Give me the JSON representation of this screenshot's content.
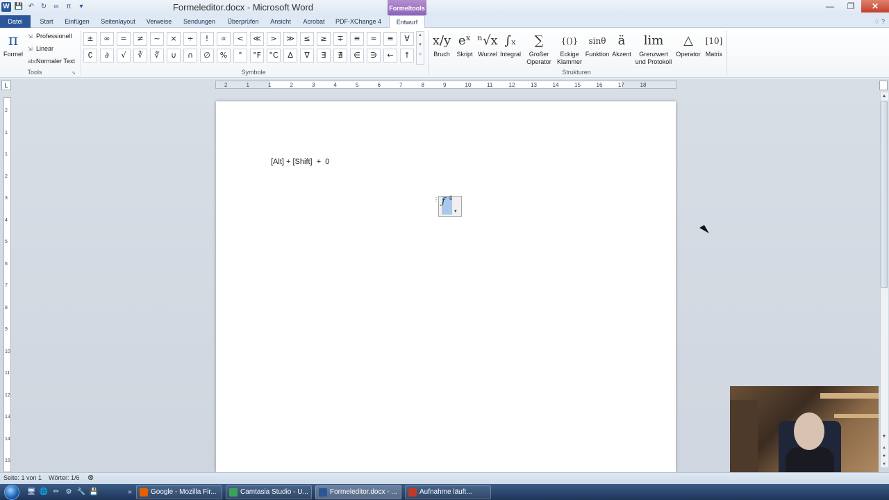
{
  "window": {
    "title": "Formeleditor.docx - Microsoft Word",
    "contextual_tab_group": "Formeltools"
  },
  "qat": {
    "word_logo": "W",
    "save": "💾",
    "undo": "↶",
    "redo": "↻",
    "infinity": "∞",
    "pi": "π",
    "more": "▾"
  },
  "window_buttons": {
    "minimize": "—",
    "restore": "❐",
    "close": "✕"
  },
  "ribbon_tabs": [
    "Datei",
    "Start",
    "Einfügen",
    "Seitenlayout",
    "Verweise",
    "Sendungen",
    "Überprüfen",
    "Ansicht",
    "Acrobat",
    "PDF-XChange 4",
    "Entwurf"
  ],
  "ribbon_controls": "♢ ?",
  "tools_group": {
    "label": "Tools",
    "formel": {
      "glyph": "π",
      "label": "Formel"
    },
    "professionell": "Professionell",
    "linear": "Linear",
    "normal_text": "Normaler Text"
  },
  "symbols_group": {
    "label": "Symbole",
    "row1": [
      "±",
      "∞",
      "=",
      "≠",
      "~",
      "×",
      "÷",
      "!",
      "∝",
      "<",
      "≪",
      ">",
      "≫",
      "≤",
      "≥",
      "∓",
      "≅",
      "≈",
      "≡",
      "∀"
    ],
    "row2": [
      "∁",
      "∂",
      "√",
      "∛",
      "∜",
      "∪",
      "∩",
      "∅",
      "%",
      "°",
      "°F",
      "°C",
      "∆",
      "∇",
      "∃",
      "∄",
      "∈",
      "∋",
      "←",
      "↑"
    ],
    "scroll": [
      "▴",
      "▾",
      "▿"
    ]
  },
  "structures_group": {
    "label": "Strukturen",
    "buttons": [
      {
        "glyph": "x/y",
        "label": "Bruch"
      },
      {
        "glyph": "eˣ",
        "label": "Skript"
      },
      {
        "glyph": "ⁿ√x",
        "label": "Wurzel"
      },
      {
        "glyph": "∫ₓ",
        "label": "Integral"
      },
      {
        "glyph": "∑",
        "label": "Großer Operator"
      },
      {
        "glyph": "{()}",
        "label": "Eckige Klammer"
      },
      {
        "glyph": "sinθ",
        "label": "Funktion"
      },
      {
        "glyph": "ä",
        "label": "Akzent"
      },
      {
        "glyph": "lim",
        "label": "Grenzwert und Protokoll"
      },
      {
        "glyph": "△",
        "label": "Operator"
      },
      {
        "glyph": "[10]",
        "label": "Matrix"
      }
    ]
  },
  "ruler": {
    "ticks": [
      "2",
      "1",
      "1",
      "2",
      "3",
      "4",
      "5",
      "6",
      "7",
      "8",
      "9",
      "10",
      "11",
      "12",
      "13",
      "14",
      "15",
      "16",
      "17",
      "18"
    ],
    "vticks": [
      "2",
      "1",
      "1",
      "2",
      "3",
      "4",
      "5",
      "6",
      "7",
      "8",
      "9",
      "10",
      "11",
      "12",
      "13",
      "14",
      "15"
    ],
    "corner": "L"
  },
  "document": {
    "text_line": "[Alt] + [Shift]  +  0",
    "equation_base": "ƒ",
    "equation_sup": "4",
    "eq_handle": "⋮",
    "eq_dropdown": "▾"
  },
  "statusbar": {
    "page": "Seite: 1 von 1",
    "words": "Wörter: 1/6"
  },
  "taskbar": {
    "quick_icons": [
      "🖥",
      "🌐",
      "✏",
      "⚙",
      "🔧",
      "💾"
    ],
    "tasks": [
      {
        "label": "Google - Mozilla Fir...",
        "color": "#e66000"
      },
      {
        "label": "Camtasia Studio - U...",
        "color": "#3aa357"
      },
      {
        "label": "Formeleditor.docx - ...",
        "color": "#2b579a"
      },
      {
        "label": "Aufnahme läuft...",
        "color": "#c0392b"
      }
    ],
    "overflow": "»"
  }
}
